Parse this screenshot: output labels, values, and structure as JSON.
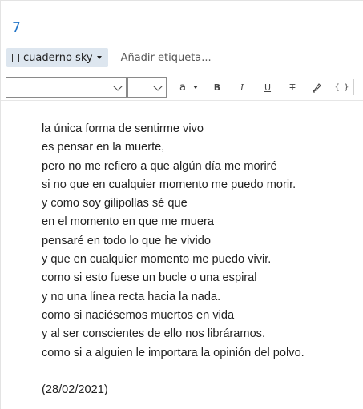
{
  "note": {
    "title": "7",
    "notebook_label": "cuaderno sky",
    "tag_placeholder": "Añadir etiqueta..."
  },
  "toolbar": {
    "font_value": "",
    "size_value": "",
    "color_label": "a",
    "bold_label": "B",
    "italic_label": "I",
    "underline_label": "U",
    "strike_label": "T",
    "code_label": "{ }"
  },
  "body": {
    "lines": [
      "la única forma de sentirme vivo",
      "es pensar en la muerte,",
      "pero no me refiero a que algún día me moriré",
      "si no que en cualquier momento me puedo morir.",
      "y como soy gilipollas sé que",
      "en el momento en que me muera",
      "pensaré en todo lo que he vivido",
      "y que en cualquier momento me puedo vivir.",
      "como si esto fuese un bucle o una espiral",
      "y no una línea recta hacia la nada.",
      "como si naciésemos muertos en vida",
      "y al ser conscientes de ello nos libráramos.",
      "como si a alguien le importara la opinión del polvo."
    ],
    "date": "(28/02/2021)"
  }
}
